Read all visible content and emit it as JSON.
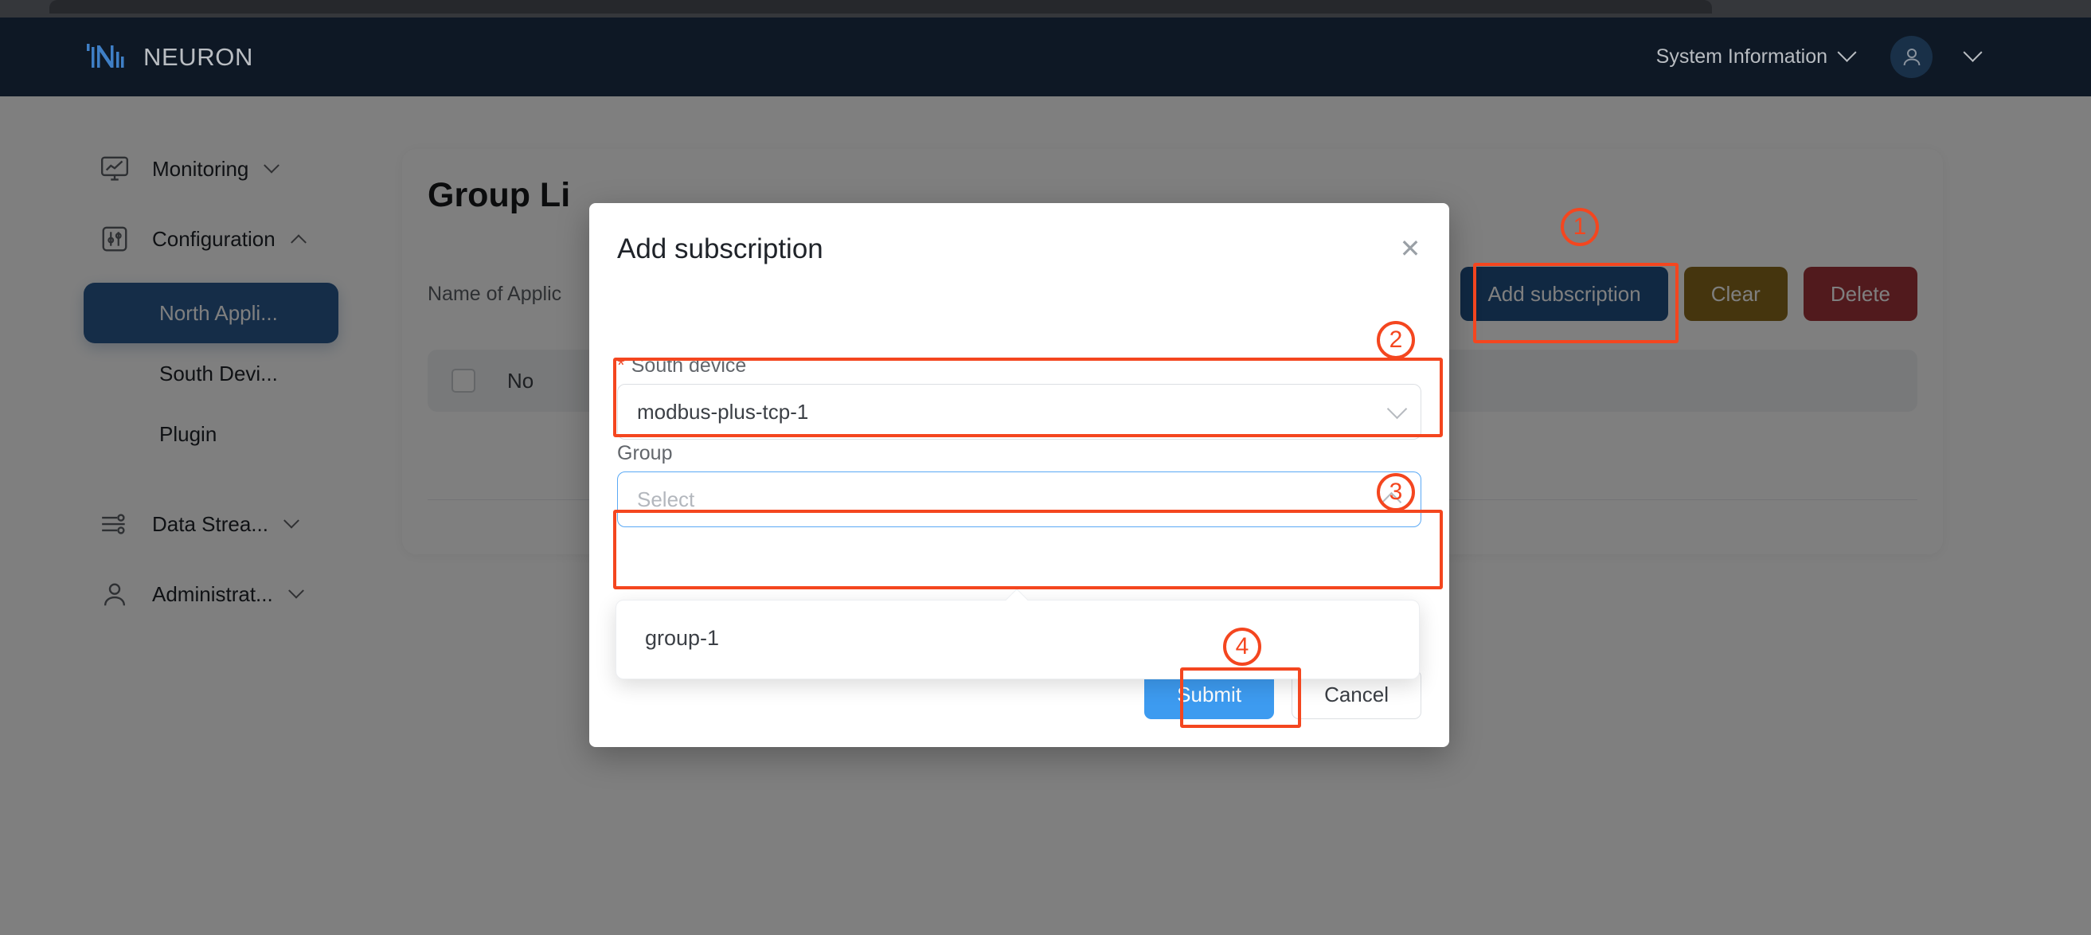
{
  "browser": {
    "tab_title": ""
  },
  "header": {
    "brand_name": "NEURON",
    "brand_logo_icon": "neuron-logo-icon",
    "system_info_label": "System Information",
    "system_info_caret_icon": "chevron-down-icon",
    "avatar_icon": "user-avatar-icon",
    "user_menu_caret_icon": "chevron-down-icon"
  },
  "sidebar": {
    "groups": [
      {
        "label": "Monitoring",
        "icon": "monitor-chart-icon",
        "caret": "chevron-down-icon"
      },
      {
        "label": "Configuration",
        "icon": "sliders-icon",
        "caret": "chevron-up-icon"
      },
      {
        "label": "Data Strea...",
        "icon": "data-stream-icon",
        "caret": "chevron-down-icon"
      },
      {
        "label": "Administrat...",
        "icon": "user-admin-icon",
        "caret": "chevron-down-icon"
      }
    ],
    "sub_items": [
      {
        "label": "North Appli...",
        "active": true
      },
      {
        "label": "South Devi...",
        "active": false
      },
      {
        "label": "Plugin",
        "active": false
      }
    ]
  },
  "main": {
    "page_title": "Group Li",
    "app_name_label": "Name of Applic",
    "toolbar": {
      "add_subscription_label": "Add subscription",
      "clear_label": "Clear",
      "delete_label": "Delete",
      "add_subscription_color": "#215184",
      "clear_color": "#8a6a1d",
      "delete_color": "#a2353a"
    },
    "table": {
      "select_all_checkbox_checked": false,
      "columns": [
        "No"
      ]
    }
  },
  "modal": {
    "title": "Add subscription",
    "close_icon": "close-icon",
    "south_device": {
      "label": "South device",
      "required_mark": "*",
      "value": "modbus-plus-tcp-1",
      "caret_icon": "chevron-down-icon"
    },
    "group": {
      "label": "Group",
      "placeholder": "Select",
      "value": "",
      "caret_icon": "chevron-up-icon",
      "options": [
        "group-1"
      ]
    },
    "submit_label": "Submit",
    "cancel_label": "Cancel",
    "submit_color": "#3d9bf0"
  },
  "annotations": {
    "color": "#f4461f",
    "steps": [
      {
        "number": "1",
        "target": "add-subscription-button"
      },
      {
        "number": "2",
        "target": "south-device-select"
      },
      {
        "number": "3",
        "target": "group-select"
      },
      {
        "number": "4",
        "target": "submit-button"
      }
    ]
  }
}
